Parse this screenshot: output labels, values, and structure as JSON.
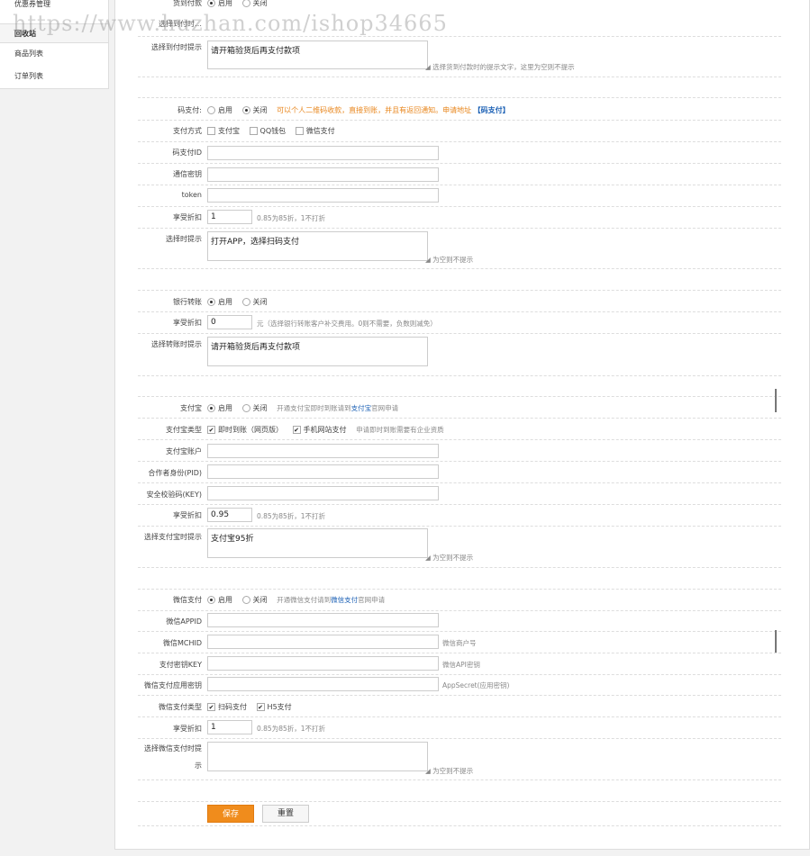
{
  "watermark": "https://www.huzhan.com/ishop34665",
  "sidebar": {
    "items": [
      {
        "label": "优惠券管理"
      },
      {
        "label": "回收站"
      },
      {
        "label": "商品列表"
      },
      {
        "label": "订单列表"
      }
    ]
  },
  "cod": {
    "label": "货到付款",
    "on_label": "启用",
    "off_label": "关闭",
    "selected": "启用",
    "hidden_label": "选择到付时…",
    "tip_label": "选择到付时提示",
    "tip_value": "请开箱验货后再支付款项",
    "tip_hint": "选择货到付款时的提示文字，这里为空则不提示"
  },
  "codepay": {
    "label": "码支付:",
    "on_label": "启用",
    "off_label": "关闭",
    "selected": "关闭",
    "notice": "可以个人二维码收款，直接到账，并且有返回通知。申请地址",
    "link": "【码支付】",
    "method_label": "支付方式",
    "methods": [
      {
        "label": "支付宝",
        "checked": false
      },
      {
        "label": "QQ钱包",
        "checked": false
      },
      {
        "label": "微信支付",
        "checked": false
      }
    ],
    "id_label": "码支付ID",
    "id_value": "",
    "key_label": "通信密钥",
    "key_value": "",
    "token_label": "token",
    "token_value": "",
    "discount_label": "享受折扣",
    "discount_value": "1",
    "discount_hint": "0.85为85折，1不打折",
    "tip_label": "选择时提示",
    "tip_value": "打开APP，选择扫码支付",
    "tip_hint": "为空则不提示"
  },
  "bank": {
    "label": "银行转账",
    "on_label": "启用",
    "off_label": "关闭",
    "selected": "启用",
    "discount_label": "享受折扣",
    "discount_value": "0",
    "discount_hint": "元（选择银行转账客户补交费用。0则不需要，负数则减免）",
    "tip_label": "选择转账时提示",
    "tip_value": "请开箱验货后再支付款项"
  },
  "alipay": {
    "label": "支付宝",
    "on_label": "启用",
    "off_label": "关闭",
    "selected": "启用",
    "notice_pre": "开通支付宝即时到账请到",
    "notice_link": "支付宝",
    "notice_post": "官网申请",
    "type_label": "支付宝类型",
    "types": [
      {
        "label": "即时到账（网页版）",
        "checked": true
      },
      {
        "label": "手机网站支付",
        "checked": true
      }
    ],
    "type_hint": "申请即时到账需要有企业资质",
    "account_label": "支付宝账户",
    "account_value": "",
    "pid_label": "合作者身份(PID)",
    "pid_value": "",
    "key_label": "安全校验码(KEY)",
    "key_value": "",
    "discount_label": "享受折扣",
    "discount_value": "0.95",
    "discount_hint": "0.85为85折，1不打折",
    "tip_label": "选择支付宝时提示",
    "tip_value": "支付宝95折",
    "tip_hint": "为空则不提示"
  },
  "wechat": {
    "label": "微信支付",
    "on_label": "启用",
    "off_label": "关闭",
    "selected": "启用",
    "notice_pre": "开通微信支付请到",
    "notice_link": "微信支付",
    "notice_post": "官网申请",
    "appid_label": "微信APPID",
    "appid_value": "",
    "mchid_label": "微信MCHID",
    "mchid_value": "",
    "mchid_hint": "微信商户号",
    "key_label": "支付密钥KEY",
    "key_value": "",
    "key_hint": "微信API密钥",
    "secret_label": "微信支付应用密钥",
    "secret_value": "",
    "secret_hint": "AppSecret(应用密钥)",
    "type_label": "微信支付类型",
    "types": [
      {
        "label": "扫码支付",
        "checked": true
      },
      {
        "label": "H5支付",
        "checked": true
      }
    ],
    "discount_label": "享受折扣",
    "discount_value": "1",
    "discount_hint": "0.85为85折，1不打折",
    "tip_label_line1": "选择微信支付时提",
    "tip_label_line2": "示",
    "tip_value": "",
    "tip_hint": "为空则不提示"
  },
  "buttons": {
    "save": "保存",
    "reset": "重置"
  }
}
